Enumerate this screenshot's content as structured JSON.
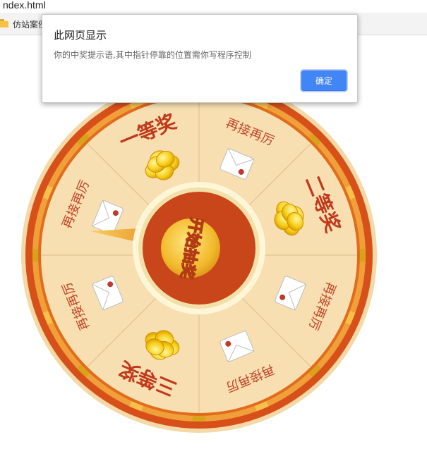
{
  "browser": {
    "url_fragment": "ndex.html",
    "bookmark_label": "仿站案例",
    "bookmark_icon": "folder-icon"
  },
  "wheel": {
    "segments": [
      {
        "label": "一等奖",
        "prize": true,
        "icon": "gold-coins-icon"
      },
      {
        "label": "再接再厉",
        "prize": false,
        "icon": "red-envelope-icon"
      },
      {
        "label": "二等奖",
        "prize": true,
        "icon": "gold-coins-icon"
      },
      {
        "label": "再接再厉",
        "prize": false,
        "icon": "red-envelope-icon"
      },
      {
        "label": "再接再厉",
        "prize": false,
        "icon": "red-envelope-icon"
      },
      {
        "label": "三等奖",
        "prize": true,
        "icon": "gold-coins-icon"
      },
      {
        "label": "再接再厉",
        "prize": false,
        "icon": "red-envelope-icon"
      },
      {
        "label": "再接再厉",
        "prize": false,
        "icon": "red-envelope-icon"
      }
    ],
    "start_button_label": "开始抽奖",
    "colors": {
      "outer_rim": "#d7501a",
      "rim_accent": "#f0a03a",
      "segment_fill": "#f7dfb2",
      "prize_text": "#c0391b",
      "retry_text": "#c2482a",
      "center_red": "#c8461a",
      "center_gold": "#f4c23a"
    }
  },
  "dialog": {
    "title": "此网页显示",
    "message": "你的中奖提示语,其中指针停靠的位置需你写程序控制",
    "ok_label": "确定",
    "accent": "#4285f4"
  }
}
